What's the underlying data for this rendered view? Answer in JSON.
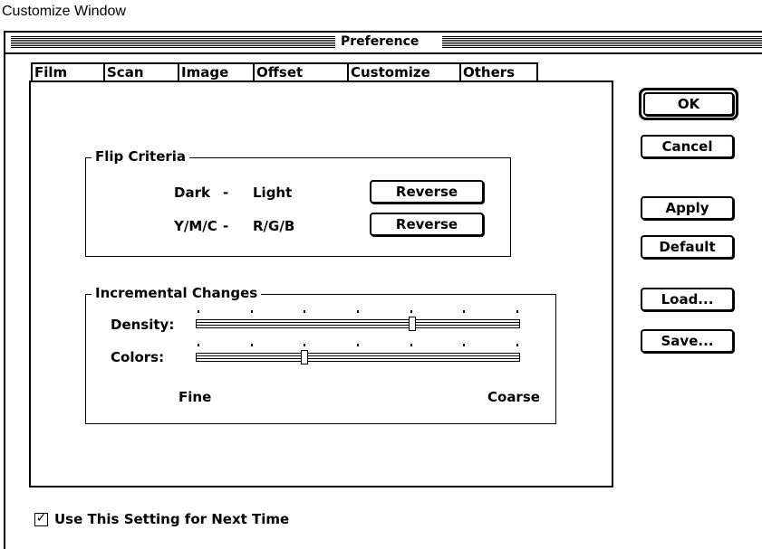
{
  "caption": "Customize Window",
  "window": {
    "title": "Preference"
  },
  "tabs": [
    {
      "label": "Film"
    },
    {
      "label": "Scan"
    },
    {
      "label": "Image"
    },
    {
      "label": "Offset"
    },
    {
      "label": "Customize"
    },
    {
      "label": "Others"
    }
  ],
  "active_tab": "Customize",
  "flip_criteria": {
    "legend": "Flip Criteria",
    "rows": [
      {
        "left": "Dark",
        "sep": "-",
        "right": "Light",
        "button": "Reverse"
      },
      {
        "left": "Y/M/C",
        "sep": "-",
        "right": "R/G/B",
        "button": "Reverse"
      }
    ]
  },
  "incremental": {
    "legend": "Incremental Changes",
    "density_label": "Density:",
    "colors_label": "Colors:",
    "density_value": 0.67,
    "colors_value": 0.33,
    "tick_count": 7,
    "fine_label": "Fine",
    "coarse_label": "Coarse"
  },
  "buttons": {
    "ok": "OK",
    "cancel": "Cancel",
    "apply": "Apply",
    "default": "Default",
    "load": "Load...",
    "save": "Save..."
  },
  "footer": {
    "checkbox_label": "Use This Setting for Next Time",
    "checked": true
  }
}
